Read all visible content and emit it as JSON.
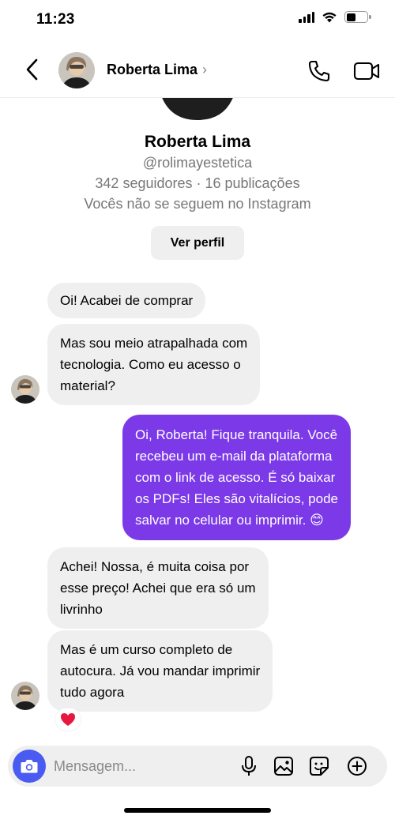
{
  "status_bar": {
    "time": "11:23"
  },
  "header": {
    "name": "Roberta Lima",
    "chevron": "›"
  },
  "profile": {
    "name": "Roberta Lima",
    "handle": "@rolimayestetica",
    "stats": "342 seguidores · 16 publicações",
    "follow_status": "Vocês não se seguem no Instagram",
    "view_profile_label": "Ver perfil"
  },
  "messages": [
    {
      "sender": "Roberta Lima",
      "direction": "incoming",
      "text": "Oi! Acabei de comprar"
    },
    {
      "sender": "Roberta Lima",
      "direction": "incoming",
      "lines": [
        "Mas sou meio atrapalhada com",
        "tecnologia. Como eu acesso o",
        "material?"
      ]
    },
    {
      "sender": "me",
      "direction": "outgoing",
      "lines": [
        "Oi, Roberta! Fique tranquila. Você",
        "recebeu um e-mail da plataforma",
        "com o link de acesso. É só baixar",
        "os PDFs! Eles são vitalícios, pode",
        "salvar no celular ou imprimir. 😊"
      ]
    },
    {
      "sender": "Roberta Lima",
      "direction": "incoming",
      "lines": [
        "Achei! Nossa, é muita coisa por",
        "esse preço! Achei que era só um",
        "livrinho"
      ]
    },
    {
      "sender": "Roberta Lima",
      "direction": "incoming",
      "lines": [
        "Mas é um curso completo de",
        "autocura. Já vou mandar imprimir",
        "tudo agora"
      ],
      "reaction": "heart"
    }
  ],
  "composer": {
    "placeholder": "Mensagem..."
  },
  "icons": [
    "back-icon",
    "phone-icon",
    "video-camera-icon",
    "camera-icon",
    "microphone-icon",
    "image-icon",
    "sticker-icon",
    "plus-icon",
    "heart-icon"
  ],
  "colors": {
    "outgoing_bubble": "#7b39e8",
    "incoming_bubble": "#efefef",
    "camera_button": "#4a5bf2",
    "muted_text": "#777777"
  }
}
